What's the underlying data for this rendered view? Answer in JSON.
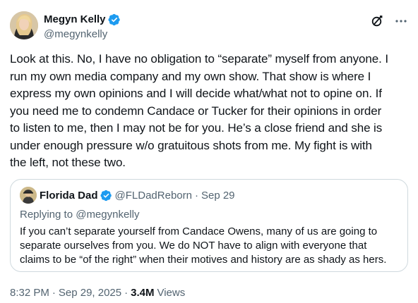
{
  "author": {
    "display_name": "Megyn Kelly",
    "handle": "@megynkelly",
    "verified": true
  },
  "header_icons": [
    "grok-icon",
    "more-icon"
  ],
  "tweet": {
    "text": "Look at this. No, I have no obligation to “separate” myself from anyone. I\nrun my own media company and my own show. That show is where I\nexpress my own opinions and I will decide what/what not to opine on. If\nyou need me to condemn Candace or Tucker for their opinions in order\nto listen to me, then I may not be for you. He’s a close friend and she is\nunder enough pressure w/o gratuitous shots from me. My fight is with\nthe left, not these two."
  },
  "quote": {
    "display_name": "Florida Dad",
    "handle": "@FLDadReborn",
    "separator": "·",
    "date": "Sep 29",
    "verified": true,
    "replying_to": "Replying to @megynkelly",
    "text": "If you can’t separate yourself from Candace Owens, many of us are going to\nseparate ourselves from you. We do NOT have to align with everyone that\nclaims to be “of the right” when their motives and history are as shady as hers."
  },
  "meta": {
    "time": "8:32 PM",
    "separator": "·",
    "date": "Sep 29, 2025",
    "views_count": "3.4M",
    "views_label": "Views"
  },
  "colors": {
    "verified_blue": "#1d9bf0",
    "secondary_text": "#536471",
    "border": "#cfd9de"
  }
}
